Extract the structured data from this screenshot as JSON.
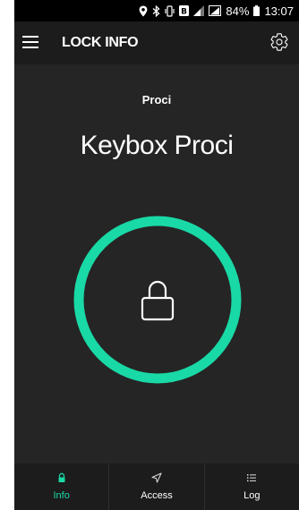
{
  "status_bar": {
    "battery_percent": "84%",
    "time": "13:07",
    "icons": [
      "location-icon",
      "bluetooth-icon",
      "vibrate-icon",
      "notification-icon",
      "signal-icon",
      "signal-icon",
      "battery-icon"
    ]
  },
  "app_bar": {
    "title": "LOCK INFO",
    "icons": [
      "menu-icon",
      "gear-icon"
    ]
  },
  "lock": {
    "subtitle": "Proci",
    "name": "Keybox Proci",
    "state_icon": "padlock-icon",
    "ring_color": "#19d9a6"
  },
  "bottom_nav": {
    "items": [
      {
        "label": "Info",
        "icon": "padlock-icon",
        "active": true
      },
      {
        "label": "Access",
        "icon": "send-icon",
        "active": false
      },
      {
        "label": "Log",
        "icon": "list-icon",
        "active": false
      }
    ]
  },
  "colors": {
    "accent": "#19d9a6",
    "background": "#252525",
    "bar": "#1c1c1c"
  }
}
